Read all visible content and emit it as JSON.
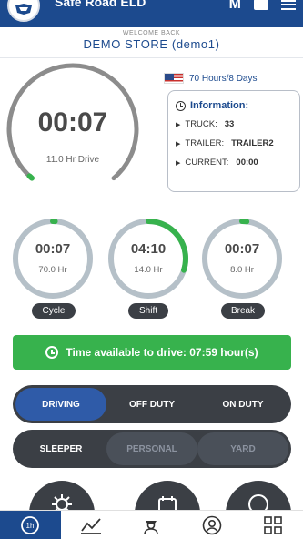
{
  "header": {
    "app_title": "Safe Road ELD",
    "icon_letter": "M"
  },
  "store": {
    "welcome": "WELCOME BACK",
    "name": "DEMO STORE",
    "user": "(demo1)"
  },
  "drive": {
    "time": "00:07",
    "label": "11.0 Hr Drive",
    "progress_fraction": 0.01
  },
  "cycle_rule": "70 Hours/8 Days",
  "information": {
    "title": "Information:",
    "rows": [
      {
        "label": "TRUCK:",
        "value": "33"
      },
      {
        "label": "TRAILER:",
        "value": "TRAILER2"
      },
      {
        "label": "CURRENT:",
        "value": "00:00"
      }
    ]
  },
  "timers": [
    {
      "time": "00:07",
      "limit": "70.0 Hr",
      "name": "Cycle",
      "progress_fraction": 0.01
    },
    {
      "time": "04:10",
      "limit": "14.0 Hr",
      "name": "Shift",
      "progress_fraction": 0.3
    },
    {
      "time": "00:07",
      "limit": "8.0 Hr",
      "name": "Break",
      "progress_fraction": 0.02
    }
  ],
  "available": "Time available to drive: 07:59 hour(s)",
  "status_row1": [
    "DRIVING",
    "OFF DUTY",
    "ON DUTY"
  ],
  "status_row2": [
    "SLEEPER",
    "PERSONAL",
    "YARD"
  ],
  "colors": {
    "brand": "#1c4a8e",
    "progress": "#37b24d",
    "track": "#b5c0c8",
    "dark": "#3b3f45",
    "active": "#2f5ba8"
  },
  "bottom_actions": [
    "settings-icon",
    "inspection-icon",
    "more-icon"
  ],
  "nav": [
    "timer-icon",
    "chart-icon",
    "driver-icon",
    "profile-icon",
    "apps-icon"
  ]
}
